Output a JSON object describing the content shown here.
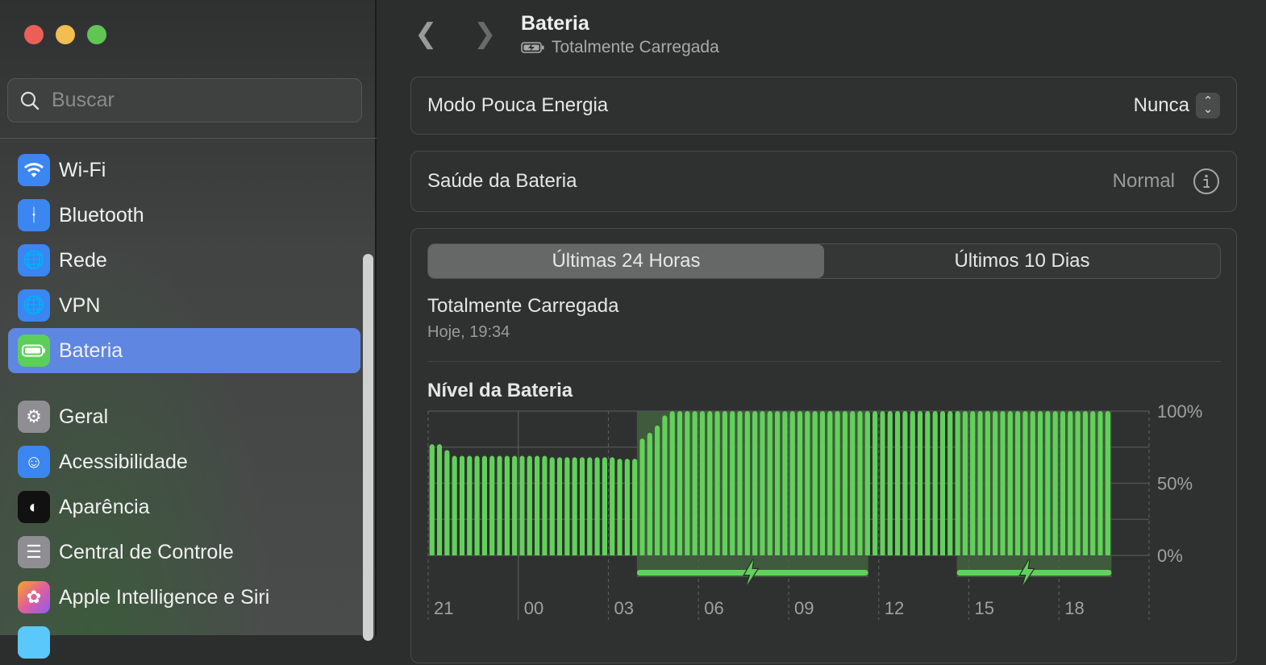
{
  "window": {
    "controls": [
      {
        "name": "close",
        "color": "#ec5f59"
      },
      {
        "name": "minimize",
        "color": "#f4bd4f"
      },
      {
        "name": "zoom",
        "color": "#61c554"
      }
    ]
  },
  "sidebar": {
    "search_placeholder": "Buscar",
    "items": [
      {
        "label": "Wi-Fi",
        "icon": "wifi-icon",
        "color": "#3b86f0"
      },
      {
        "label": "Bluetooth",
        "icon": "bluetooth-icon",
        "color": "#3b86f0"
      },
      {
        "label": "Rede",
        "icon": "globe-icon",
        "color": "#3b86f0"
      },
      {
        "label": "VPN",
        "icon": "vpn-globe-icon",
        "color": "#3b86f0"
      },
      {
        "label": "Bateria",
        "icon": "battery-icon",
        "color": "#5ccf5a",
        "selected": true
      },
      {
        "label": "Geral",
        "icon": "gear-icon",
        "color": "#8e8e93"
      },
      {
        "label": "Acessibilidade",
        "icon": "accessibility-icon",
        "color": "#3b86f0"
      },
      {
        "label": "Aparência",
        "icon": "appearance-icon",
        "color": "#111111"
      },
      {
        "label": "Central de Controle",
        "icon": "control-center-icon",
        "color": "#8e8e93"
      },
      {
        "label": "Apple Intelligence e Siri",
        "icon": "siri-icon",
        "color": "#e0609a"
      }
    ]
  },
  "header": {
    "title": "Bateria",
    "subtitle": "Totalmente Carregada"
  },
  "low_power": {
    "label": "Modo Pouca Energia",
    "value": "Nunca"
  },
  "health": {
    "label": "Saúde da Bateria",
    "value": "Normal"
  },
  "usage": {
    "tabs": [
      "Últimas 24 Horas",
      "Últimos 10 Dias"
    ],
    "active_tab": 0,
    "status": "Totalmente Carregada",
    "status_time": "Hoje, 19:34"
  },
  "chart_data": {
    "type": "bar",
    "title": "Nível da Bateria",
    "accent": "#62d15a",
    "x_range_hours": [
      0,
      24
    ],
    "bar_interval_hours": 0.25,
    "first_bar_hour": 0.1,
    "x_ticks": [
      {
        "hour": 0,
        "label": "21"
      },
      {
        "hour": 3,
        "label": "00"
      },
      {
        "hour": 6,
        "label": "03"
      },
      {
        "hour": 9,
        "label": "06"
      },
      {
        "hour": 12,
        "label": "09"
      },
      {
        "hour": 15,
        "label": "12"
      },
      {
        "hour": 18,
        "label": "15"
      },
      {
        "hour": 21,
        "label": "18"
      }
    ],
    "y_ticks": [
      {
        "value": 100,
        "label": "100%"
      },
      {
        "value": 50,
        "label": "50%"
      },
      {
        "value": 0,
        "label": "0%"
      }
    ],
    "ylim": [
      0,
      100
    ],
    "values": [
      77,
      77,
      73,
      69,
      69,
      69,
      69,
      69,
      69,
      69,
      69,
      69,
      69,
      69,
      69,
      69,
      68,
      68,
      68,
      68,
      68,
      68,
      68,
      68,
      68,
      67,
      67,
      67,
      81,
      85,
      90,
      97,
      100,
      100,
      100,
      100,
      100,
      100,
      100,
      100,
      100,
      100,
      100,
      100,
      100,
      100,
      100,
      100,
      100,
      100,
      100,
      100,
      100,
      100,
      100,
      100,
      100,
      100,
      100,
      100,
      100,
      100,
      100,
      100,
      100,
      100,
      100,
      100,
      100,
      100,
      100,
      100,
      100,
      100,
      100,
      100,
      100,
      100,
      100,
      100,
      100,
      100,
      100,
      100,
      100,
      100,
      100,
      100,
      100,
      100,
      100
    ],
    "charging_periods": [
      [
        6.95,
        14.65
      ],
      [
        17.6,
        22.75
      ]
    ]
  }
}
